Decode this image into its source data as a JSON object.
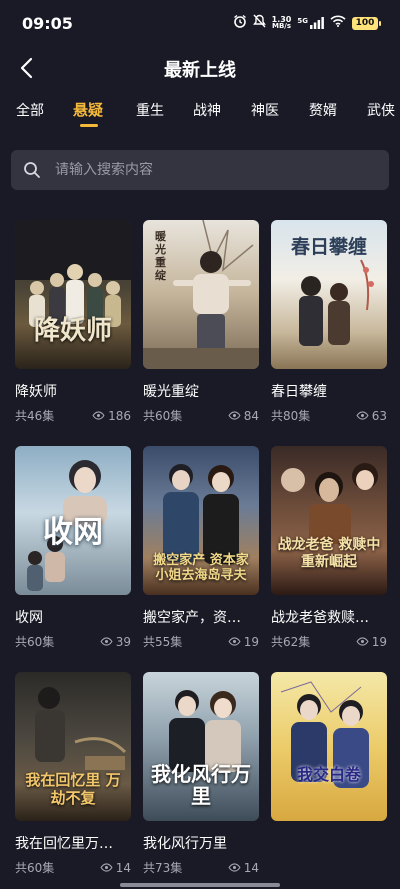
{
  "status": {
    "time": "09:05",
    "net_speed_value": "1.30",
    "net_speed_unit": "MB/s",
    "signal_label": "5G",
    "battery": "100"
  },
  "header": {
    "title": "最新上线",
    "back_icon": "chevron-left-icon"
  },
  "tabs": [
    {
      "label": "全部",
      "active": false
    },
    {
      "label": "悬疑",
      "active": true
    },
    {
      "label": "重生",
      "active": false
    },
    {
      "label": "战神",
      "active": false
    },
    {
      "label": "神医",
      "active": false
    },
    {
      "label": "赘婿",
      "active": false
    },
    {
      "label": "武侠",
      "active": false
    }
  ],
  "search": {
    "placeholder": "请输入搜索内容",
    "value": "",
    "icon": "search-icon"
  },
  "colors": {
    "accent": "#f5b93a",
    "background": "#1a1a26",
    "search_bg": "#33343f"
  },
  "dramas": [
    {
      "title": "降妖师",
      "episodes": "共46集",
      "views": "186",
      "poster_text": "降妖师"
    },
    {
      "title": "暖光重绽",
      "episodes": "共60集",
      "views": "84",
      "poster_text": "暖光重绽"
    },
    {
      "title": "春日攀缠",
      "episodes": "共80集",
      "views": "63",
      "poster_text": "春日攀缠"
    },
    {
      "title": "收网",
      "episodes": "共60集",
      "views": "39",
      "poster_text": "收网"
    },
    {
      "title": "搬空家产，资…",
      "episodes": "共55集",
      "views": "19",
      "poster_text": "搬空家产 资本家小姐去海岛寻夫"
    },
    {
      "title": "战龙老爸救赎…",
      "episodes": "共62集",
      "views": "19",
      "poster_text": "战龙老爸 救赎中重新崛起"
    },
    {
      "title": "我在回忆里万…",
      "episodes": "共60集",
      "views": "14",
      "poster_text": "我在回忆里 万劫不复"
    },
    {
      "title": "我化风行万里",
      "episodes": "共73集",
      "views": "14",
      "poster_text": "我化风行万里"
    },
    {
      "title": "",
      "episodes": "",
      "views": "",
      "poster_text": "我交白卷"
    }
  ]
}
